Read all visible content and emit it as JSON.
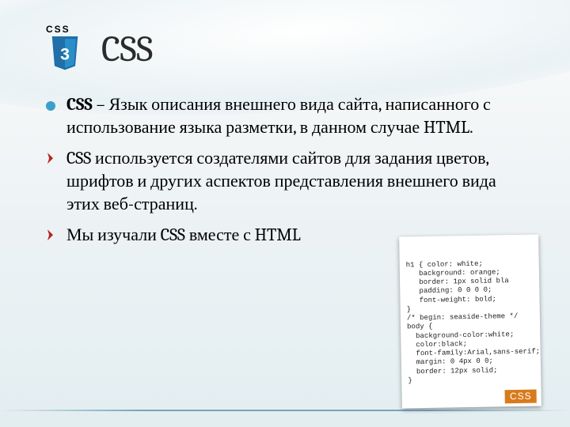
{
  "title": "CSS",
  "logo": {
    "label": "CSS",
    "num": "3"
  },
  "bullets": [
    {
      "lead": "CSS",
      "text": " – Язык описания внешнего вида сайта, написанного с использование языка разметки, в данном случае HTML.",
      "style": "disc"
    },
    {
      "lead": "",
      "text": "CSS используется создателями сайтов для задания цветов, шрифтов и других аспектов представления внешнего вида этих веб-страниц.",
      "style": "arrow"
    },
    {
      "lead": "",
      "text": "Мы изучали CSS вместе с HTML",
      "style": "arrow"
    }
  ],
  "code": {
    "lines": "h1 { color: white;\n   background: orange;\n   border: 1px solid bla\n   padding: 0 0 0 0;\n   font-weight: bold;\n}\n/* begin: seaside-theme */\nbody {\n  background-color:white;\n  color:black;\n  font-family:Arial,sans-serif;\n  margin: 0 4px 0 0;\n  border: 12px solid;\n}",
    "tag": "CSS"
  }
}
